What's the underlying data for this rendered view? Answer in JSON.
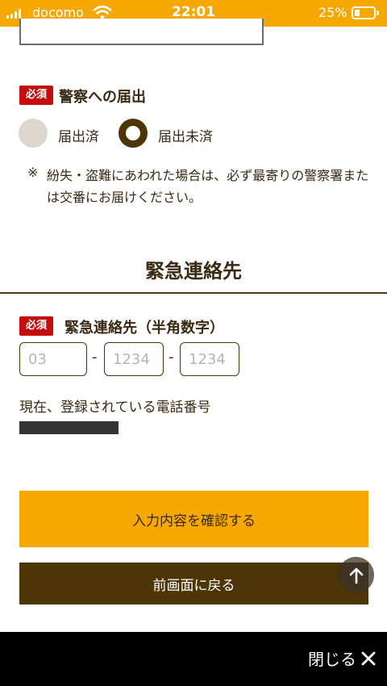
{
  "status_bar": {
    "carrier": "docomo",
    "time": "22:01",
    "battery_percent": "25%",
    "battery_level": 0.25
  },
  "police_report": {
    "badge": "必須",
    "label": "警察への届出",
    "options": [
      "届出済",
      "届出未済"
    ],
    "selected": "届出未済",
    "note_mark": "※",
    "note": "紛失・盗難にあわれた場合は、必ず最寄りの警察署または交番にお届けください。"
  },
  "emergency_contact": {
    "section_title": "緊急連絡先",
    "badge": "必須",
    "label": "緊急連絡先（半角数字）",
    "phone": {
      "part1_placeholder": "03",
      "part2_placeholder": "1234",
      "part3_placeholder": "1234",
      "separator": "-"
    },
    "current_label": "現在、登録されている電話番号"
  },
  "buttons": {
    "confirm": "入力内容を確認する",
    "back": "前画面に戻る"
  },
  "bottom_bar": {
    "close_label": "閉じる"
  },
  "colors": {
    "accent": "#f6a800",
    "brown": "#4d3508",
    "required_red": "#c40d0d"
  }
}
